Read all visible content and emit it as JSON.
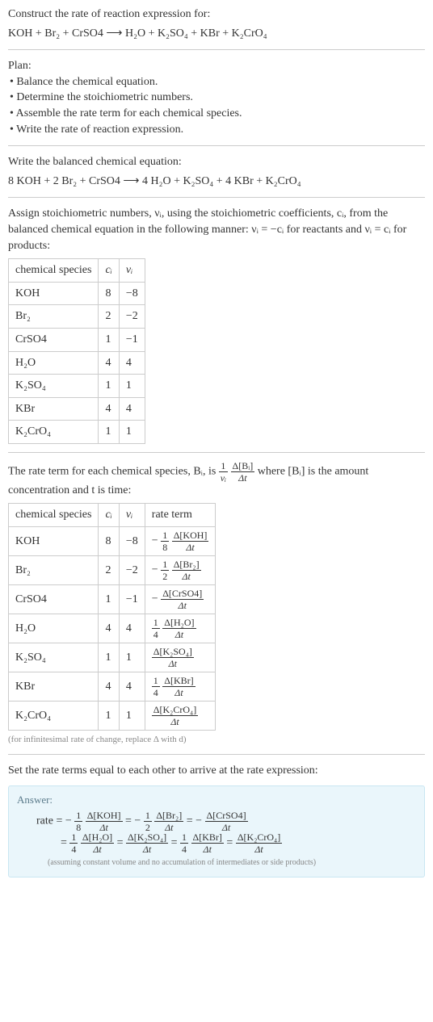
{
  "intro": {
    "construct_line": "Construct the rate of reaction expression for:",
    "equation": "KOH + Br₂ + CrSO4 ⟶ H₂O + K₂SO₄ + KBr + K₂CrO₄"
  },
  "plan": {
    "heading": "Plan:",
    "items": [
      "• Balance the chemical equation.",
      "• Determine the stoichiometric numbers.",
      "• Assemble the rate term for each chemical species.",
      "• Write the rate of reaction expression."
    ]
  },
  "balanced": {
    "heading": "Write the balanced chemical equation:",
    "equation": "8 KOH + 2 Br₂ + CrSO4 ⟶ 4 H₂O + K₂SO₄ + 4 KBr + K₂CrO₄"
  },
  "assign": {
    "text": "Assign stoichiometric numbers, νᵢ, using the stoichiometric coefficients, cᵢ, from the balanced chemical equation in the following manner: νᵢ = −cᵢ for reactants and νᵢ = cᵢ for products:"
  },
  "table1": {
    "headers": {
      "species": "chemical species",
      "ci": "cᵢ",
      "vi": "νᵢ"
    },
    "rows": [
      {
        "species": "KOH",
        "ci": "8",
        "vi": "−8"
      },
      {
        "species": "Br₂",
        "ci": "2",
        "vi": "−2"
      },
      {
        "species": "CrSO4",
        "ci": "1",
        "vi": "−1"
      },
      {
        "species": "H₂O",
        "ci": "4",
        "vi": "4"
      },
      {
        "species": "K₂SO₄",
        "ci": "1",
        "vi": "1"
      },
      {
        "species": "KBr",
        "ci": "4",
        "vi": "4"
      },
      {
        "species": "K₂CrO₄",
        "ci": "1",
        "vi": "1"
      }
    ]
  },
  "rate_intro": {
    "prefix": "The rate term for each chemical species, Bᵢ, is ",
    "one": "1",
    "vi": "νᵢ",
    "dBi": "Δ[Bᵢ]",
    "dt": "Δt",
    "suffix1": " where [Bᵢ] is the amount",
    "suffix2": "concentration and t is time:"
  },
  "table2": {
    "headers": {
      "species": "chemical species",
      "ci": "cᵢ",
      "vi": "νᵢ",
      "rate": "rate term"
    },
    "rows": [
      {
        "species": "KOH",
        "ci": "8",
        "vi": "−8",
        "sign": "−",
        "coef_num": "1",
        "coef_den": "8",
        "dnum": "Δ[KOH]",
        "dden": "Δt"
      },
      {
        "species": "Br₂",
        "ci": "2",
        "vi": "−2",
        "sign": "−",
        "coef_num": "1",
        "coef_den": "2",
        "dnum": "Δ[Br₂]",
        "dden": "Δt"
      },
      {
        "species": "CrSO4",
        "ci": "1",
        "vi": "−1",
        "sign": "−",
        "coef_num": "",
        "coef_den": "",
        "dnum": "Δ[CrSO4]",
        "dden": "Δt"
      },
      {
        "species": "H₂O",
        "ci": "4",
        "vi": "4",
        "sign": "",
        "coef_num": "1",
        "coef_den": "4",
        "dnum": "Δ[H₂O]",
        "dden": "Δt"
      },
      {
        "species": "K₂SO₄",
        "ci": "1",
        "vi": "1",
        "sign": "",
        "coef_num": "",
        "coef_den": "",
        "dnum": "Δ[K₂SO₄]",
        "dden": "Δt"
      },
      {
        "species": "KBr",
        "ci": "4",
        "vi": "4",
        "sign": "",
        "coef_num": "1",
        "coef_den": "4",
        "dnum": "Δ[KBr]",
        "dden": "Δt"
      },
      {
        "species": "K₂CrO₄",
        "ci": "1",
        "vi": "1",
        "sign": "",
        "coef_num": "",
        "coef_den": "",
        "dnum": "Δ[K₂CrO₄]",
        "dden": "Δt"
      }
    ]
  },
  "inf_note": "(for infinitesimal rate of change, replace Δ with d)",
  "set_equal": "Set the rate terms equal to each other to arrive at the rate expression:",
  "answer": {
    "label": "Answer:",
    "rate_prefix": "rate = ",
    "eq_prefix": "= ",
    "t1": {
      "sign": "−",
      "cn": "1",
      "cd": "8",
      "dn": "Δ[KOH]",
      "dd": "Δt"
    },
    "t2": {
      "sign": "−",
      "cn": "1",
      "cd": "2",
      "dn": "Δ[Br₂]",
      "dd": "Δt"
    },
    "t3": {
      "sign": "−",
      "cn": "",
      "cd": "",
      "dn": "Δ[CrSO4]",
      "dd": "Δt"
    },
    "t4": {
      "sign": "",
      "cn": "1",
      "cd": "4",
      "dn": "Δ[H₂O]",
      "dd": "Δt"
    },
    "t5": {
      "sign": "",
      "cn": "",
      "cd": "",
      "dn": "Δ[K₂SO₄]",
      "dd": "Δt"
    },
    "t6": {
      "sign": "",
      "cn": "1",
      "cd": "4",
      "dn": "Δ[KBr]",
      "dd": "Δt"
    },
    "t7": {
      "sign": "",
      "cn": "",
      "cd": "",
      "dn": "Δ[K₂CrO₄]",
      "dd": "Δt"
    },
    "note": "(assuming constant volume and no accumulation of intermediates or side products)"
  },
  "eq_sign": " = "
}
